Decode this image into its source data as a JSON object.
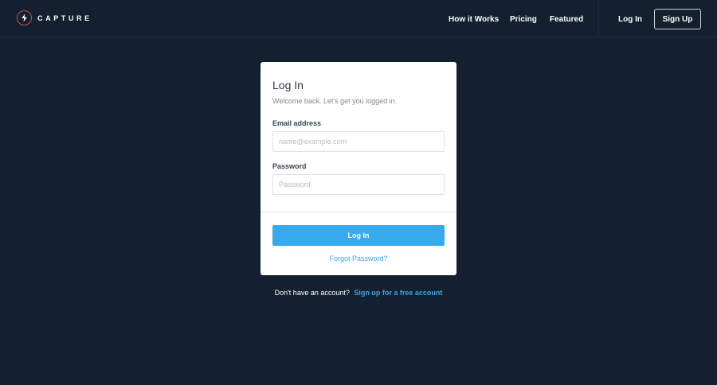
{
  "brand": {
    "name": "CAPTURE",
    "mark_icon": "lightning-bolt-icon",
    "mark_color": "#d94a4a"
  },
  "nav": {
    "how_it_works": "How it Works",
    "pricing": "Pricing",
    "featured": "Featured",
    "log_in": "Log In",
    "sign_up": "Sign Up"
  },
  "login_card": {
    "title": "Log In",
    "subtitle": "Welcome back. Let's get you logged in.",
    "email_label": "Email address",
    "email_placeholder": "name@example.com",
    "email_value": "",
    "password_label": "Password",
    "password_placeholder": "Password",
    "password_value": "",
    "submit_label": "Log In",
    "forgot_label": "Forgot Password?"
  },
  "footer": {
    "prompt": "Don't have an account?",
    "signup_link": "Sign up for a free account"
  },
  "colors": {
    "background": "#13202f",
    "accent": "#37a9ee",
    "card": "#ffffff"
  }
}
